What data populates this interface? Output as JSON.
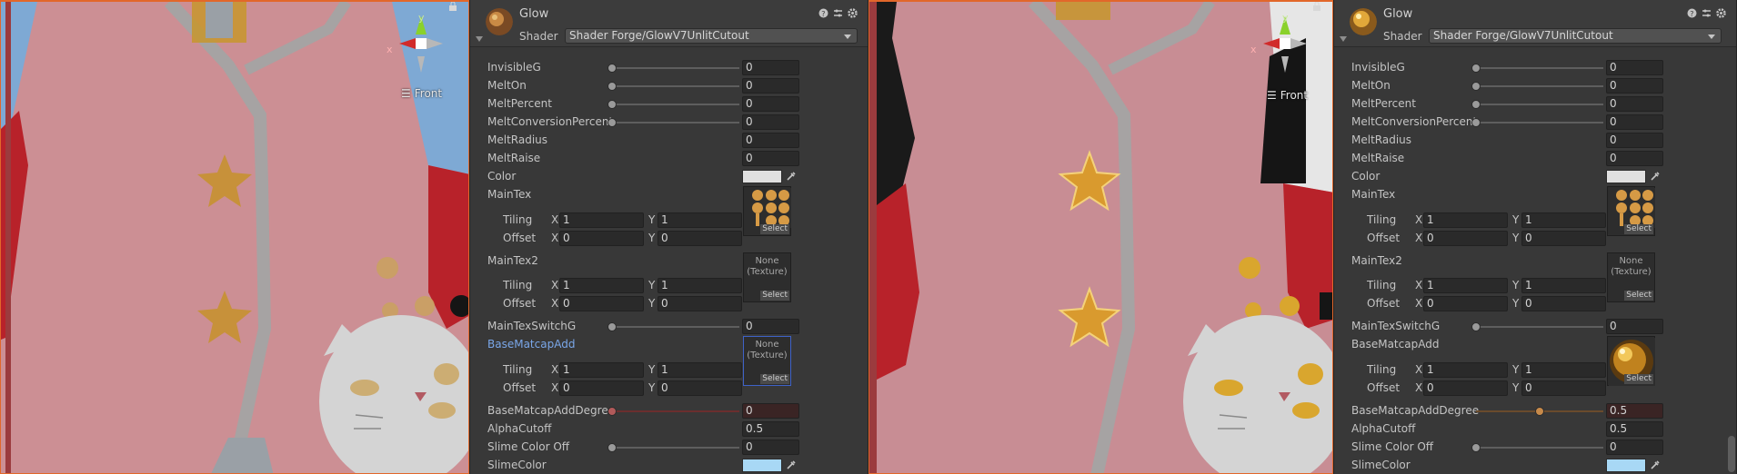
{
  "scene_left": {
    "gizmo": {
      "y": "y",
      "x": "x",
      "view": "Front"
    }
  },
  "scene_right": {
    "gizmo": {
      "y": "y",
      "x": "x",
      "view": "Front"
    }
  },
  "inspector_left": {
    "material_name": "Glow",
    "shader_label": "Shader",
    "shader_value": "Shader Forge/GlowV7UnlitCutout",
    "props": {
      "invisible_g": {
        "label": "InvisibleG",
        "value": "0"
      },
      "melt_on": {
        "label": "MeltOn",
        "value": "0"
      },
      "melt_percent": {
        "label": "MeltPercent",
        "value": "0"
      },
      "melt_conversion": {
        "label": "MeltConversionPercent",
        "value": "0"
      },
      "melt_radius": {
        "label": "MeltRadius",
        "value": "0"
      },
      "melt_raise": {
        "label": "MeltRaise",
        "value": "0"
      },
      "color": {
        "label": "Color",
        "value": "#e0e0e0"
      },
      "main_tex": {
        "label": "MainTex",
        "tiling_label": "Tiling",
        "offset_label": "Offset",
        "tiling_x": "1",
        "tiling_y": "1",
        "offset_x": "0",
        "offset_y": "0",
        "select": "Select"
      },
      "main_tex2": {
        "label": "MainTex2",
        "tiling_label": "Tiling",
        "offset_label": "Offset",
        "tiling_x": "1",
        "tiling_y": "1",
        "offset_x": "0",
        "offset_y": "0",
        "none": "None\n(Texture)",
        "select": "Select"
      },
      "main_tex_switch": {
        "label": "MainTexSwitchG",
        "value": "0"
      },
      "base_matcap": {
        "label": "BaseMatcapAdd",
        "tiling_label": "Tiling",
        "offset_label": "Offset",
        "tiling_x": "1",
        "tiling_y": "1",
        "offset_x": "0",
        "offset_y": "0",
        "none": "None\n(Texture)",
        "select": "Select"
      },
      "base_matcap_degree": {
        "label": "BaseMatcapAddDegree",
        "value": "0"
      },
      "alpha_cutoff": {
        "label": "AlphaCutoff",
        "value": "0.5"
      },
      "slime_color_off": {
        "label": "Slime Color Off",
        "value": "0"
      },
      "slime_color": {
        "label": "SlimeColor",
        "value": "#a8d8f5"
      }
    },
    "axis_x": "X",
    "axis_y": "Y"
  },
  "inspector_right": {
    "material_name": "Glow",
    "shader_label": "Shader",
    "shader_value": "Shader Forge/GlowV7UnlitCutout",
    "props": {
      "invisible_g": {
        "label": "InvisibleG",
        "value": "0"
      },
      "melt_on": {
        "label": "MeltOn",
        "value": "0"
      },
      "melt_percent": {
        "label": "MeltPercent",
        "value": "0"
      },
      "melt_conversion": {
        "label": "MeltConversionPercent",
        "value": "0"
      },
      "melt_radius": {
        "label": "MeltRadius",
        "value": "0"
      },
      "melt_raise": {
        "label": "MeltRaise",
        "value": "0"
      },
      "color": {
        "label": "Color",
        "value": "#e0e0e0"
      },
      "main_tex": {
        "label": "MainTex",
        "tiling_label": "Tiling",
        "offset_label": "Offset",
        "tiling_x": "1",
        "tiling_y": "1",
        "offset_x": "0",
        "offset_y": "0",
        "select": "Select"
      },
      "main_tex2": {
        "label": "MainTex2",
        "tiling_label": "Tiling",
        "offset_label": "Offset",
        "tiling_x": "1",
        "tiling_y": "1",
        "offset_x": "0",
        "offset_y": "0",
        "none": "None\n(Texture)",
        "select": "Select"
      },
      "main_tex_switch": {
        "label": "MainTexSwitchG",
        "value": "0"
      },
      "base_matcap": {
        "label": "BaseMatcapAdd",
        "tiling_label": "Tiling",
        "offset_label": "Offset",
        "tiling_x": "1",
        "tiling_y": "1",
        "offset_x": "0",
        "offset_y": "0",
        "select": "Select"
      },
      "base_matcap_degree": {
        "label": "BaseMatcapAddDegree",
        "value": "0.5"
      },
      "alpha_cutoff": {
        "label": "AlphaCutoff",
        "value": "0.5"
      },
      "slime_color_off": {
        "label": "Slime Color Off",
        "value": "0"
      },
      "slime_color": {
        "label": "SlimeColor",
        "value": "#a8d8f5"
      }
    },
    "axis_x": "X",
    "axis_y": "Y"
  },
  "colors": {
    "selection_outline": "#e2672a",
    "inspector_bg": "#383838",
    "field_bg": "#2a2a2a",
    "highlight_label": "#7aa7e9",
    "texture_focus": "#3e62c7"
  }
}
